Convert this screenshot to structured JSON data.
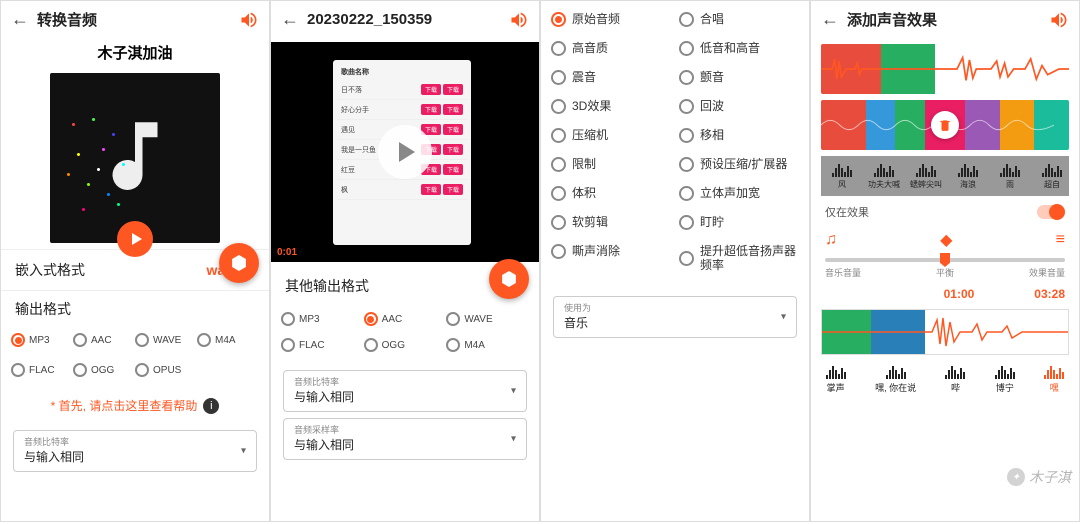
{
  "s1": {
    "title": "转换音频",
    "song": "木子淇加油",
    "embed_label": "嵌入式格式",
    "embed_value": "wav",
    "out_label": "输出格式",
    "formats": [
      "MP3",
      "AAC",
      "WAVE",
      "M4A",
      "FLAC",
      "OGG",
      "OPUS"
    ],
    "selected_format": "MP3",
    "help": "* 首先, 请点击这里查看帮助",
    "bitrate_label": "音频比特率",
    "bitrate_value": "与输入相同"
  },
  "s2": {
    "title": "20230222_150359",
    "playlist_header": "歌曲名称",
    "playlist": [
      {
        "name": "日不落",
        "t1": "下载",
        "t2": "下载"
      },
      {
        "name": "好心分手",
        "t1": "下载",
        "t2": "下载"
      },
      {
        "name": "遇见",
        "t1": "下载",
        "t2": "下载"
      },
      {
        "name": "我是一只鱼",
        "t1": "下载",
        "t2": "下载"
      },
      {
        "name": "红豆",
        "t1": "下载",
        "t2": "下载"
      },
      {
        "name": "枫",
        "t1": "下载",
        "t2": "下载"
      }
    ],
    "timestamp": "0:01",
    "other_out_label": "其他输出格式",
    "formats": [
      "MP3",
      "AAC",
      "WAVE",
      "FLAC",
      "OGG",
      "M4A"
    ],
    "selected_format": "AAC",
    "bitrate_label": "音频比特率",
    "bitrate_value": "与输入相同",
    "sample_label": "音频采样率",
    "sample_value": "与输入相同"
  },
  "s3": {
    "left": [
      "原始音频",
      "高音质",
      "震音",
      "3D效果",
      "压缩机",
      "限制",
      "体积",
      "软剪辑",
      "嘶声消除"
    ],
    "right": [
      "合唱",
      "低音和高音",
      "颤音",
      "回波",
      "移相",
      "预设压缩/扩展器",
      "立体声加宽",
      "盯眝",
      "提升超低音扬声器频率"
    ],
    "selected": "原始音频",
    "use_label": "使用为",
    "use_value": "音乐"
  },
  "s4": {
    "title": "添加声音效果",
    "sounds": [
      "风",
      "功夫大喊",
      "蟋蟀尖叫",
      "海浪",
      "雨",
      "超自"
    ],
    "toggle_label": "仅在效果",
    "slider_left": "音乐音量",
    "slider_mid": "平衡",
    "slider_right": "效果音量",
    "time_a": "01:00",
    "time_b": "03:28",
    "bottom": [
      "掌声",
      "嘿, 你在说",
      "哔",
      "博宁",
      "嘿"
    ],
    "watermark": "木子淇"
  }
}
